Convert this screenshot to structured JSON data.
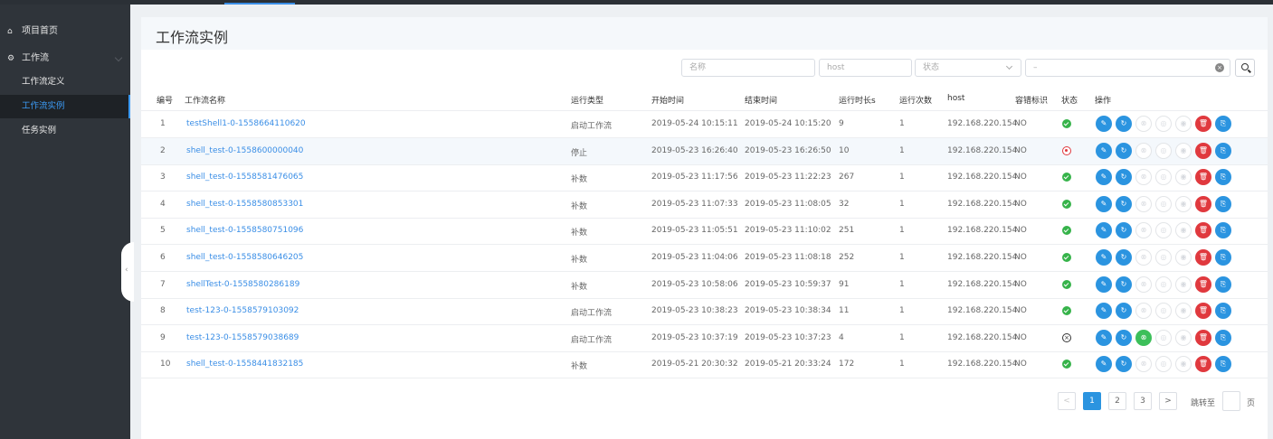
{
  "sidebar": {
    "items": [
      {
        "label": "项目首页",
        "icon": "home-icon"
      },
      {
        "label": "工作流",
        "icon": "gear-icon"
      }
    ],
    "subitems": [
      {
        "label": "工作流定义",
        "active": false
      },
      {
        "label": "工作流实例",
        "active": true
      },
      {
        "label": "任务实例",
        "active": false
      }
    ]
  },
  "page": {
    "title": "工作流实例"
  },
  "filters": {
    "name_placeholder": "名称",
    "host_placeholder": "host",
    "state_placeholder": "状态",
    "date_separator": "–"
  },
  "table": {
    "headers": [
      "编号",
      "工作流名称",
      "运行类型",
      "开始时间",
      "结束时间",
      "运行时长s",
      "运行次数",
      "host",
      "容错标识",
      "状态",
      "操作"
    ],
    "rows": [
      {
        "id": "1",
        "name": "testShell1-0-1558664110620",
        "type": "启动工作流",
        "start": "2019-05-24 10:15:11",
        "end": "2019-05-24 10:15:20",
        "duration": "9",
        "runs": "1",
        "host": "192.168.220.154",
        "fault": "NO",
        "state": "success"
      },
      {
        "id": "2",
        "name": "shell_test-0-1558600000040",
        "type": "停止",
        "start": "2019-05-23 16:26:40",
        "end": "2019-05-23 16:26:50",
        "duration": "10",
        "runs": "1",
        "host": "192.168.220.154",
        "fault": "NO",
        "state": "stopped"
      },
      {
        "id": "3",
        "name": "shell_test-0-1558581476065",
        "type": "补数",
        "start": "2019-05-23 11:17:56",
        "end": "2019-05-23 11:22:23",
        "duration": "267",
        "runs": "1",
        "host": "192.168.220.154",
        "fault": "NO",
        "state": "success"
      },
      {
        "id": "4",
        "name": "shell_test-0-1558580853301",
        "type": "补数",
        "start": "2019-05-23 11:07:33",
        "end": "2019-05-23 11:08:05",
        "duration": "32",
        "runs": "1",
        "host": "192.168.220.154",
        "fault": "NO",
        "state": "success"
      },
      {
        "id": "5",
        "name": "shell_test-0-1558580751096",
        "type": "补数",
        "start": "2019-05-23 11:05:51",
        "end": "2019-05-23 11:10:02",
        "duration": "251",
        "runs": "1",
        "host": "192.168.220.154",
        "fault": "NO",
        "state": "success"
      },
      {
        "id": "6",
        "name": "shell_test-0-1558580646205",
        "type": "补数",
        "start": "2019-05-23 11:04:06",
        "end": "2019-05-23 11:08:18",
        "duration": "252",
        "runs": "1",
        "host": "192.168.220.154",
        "fault": "NO",
        "state": "success"
      },
      {
        "id": "7",
        "name": "shellTest-0-1558580286189",
        "type": "补数",
        "start": "2019-05-23 10:58:06",
        "end": "2019-05-23 10:59:37",
        "duration": "91",
        "runs": "1",
        "host": "192.168.220.154",
        "fault": "NO",
        "state": "success"
      },
      {
        "id": "8",
        "name": "test-123-0-1558579103092",
        "type": "启动工作流",
        "start": "2019-05-23 10:38:23",
        "end": "2019-05-23 10:38:34",
        "duration": "11",
        "runs": "1",
        "host": "192.168.220.154",
        "fault": "NO",
        "state": "success"
      },
      {
        "id": "9",
        "name": "test-123-0-1558579038689",
        "type": "启动工作流",
        "start": "2019-05-23 10:37:19",
        "end": "2019-05-23 10:37:23",
        "duration": "4",
        "runs": "1",
        "host": "192.168.220.154",
        "fault": "NO",
        "state": "failed"
      },
      {
        "id": "10",
        "name": "shell_test-0-1558441832185",
        "type": "补数",
        "start": "2019-05-21 20:30:32",
        "end": "2019-05-21 20:33:24",
        "duration": "172",
        "runs": "1",
        "host": "192.168.220.154",
        "fault": "NO",
        "state": "success"
      }
    ]
  },
  "pagination": {
    "prev": "<",
    "pages": [
      "1",
      "2",
      "3"
    ],
    "current": "1",
    "next": ">",
    "jump_label": "跳转至",
    "page_suffix": "页"
  },
  "colors": {
    "sidebar_bg": "#2f343a",
    "accent": "#2b94e0",
    "link": "#3a8ee6",
    "success": "#36b34a",
    "danger": "#e0393e"
  }
}
